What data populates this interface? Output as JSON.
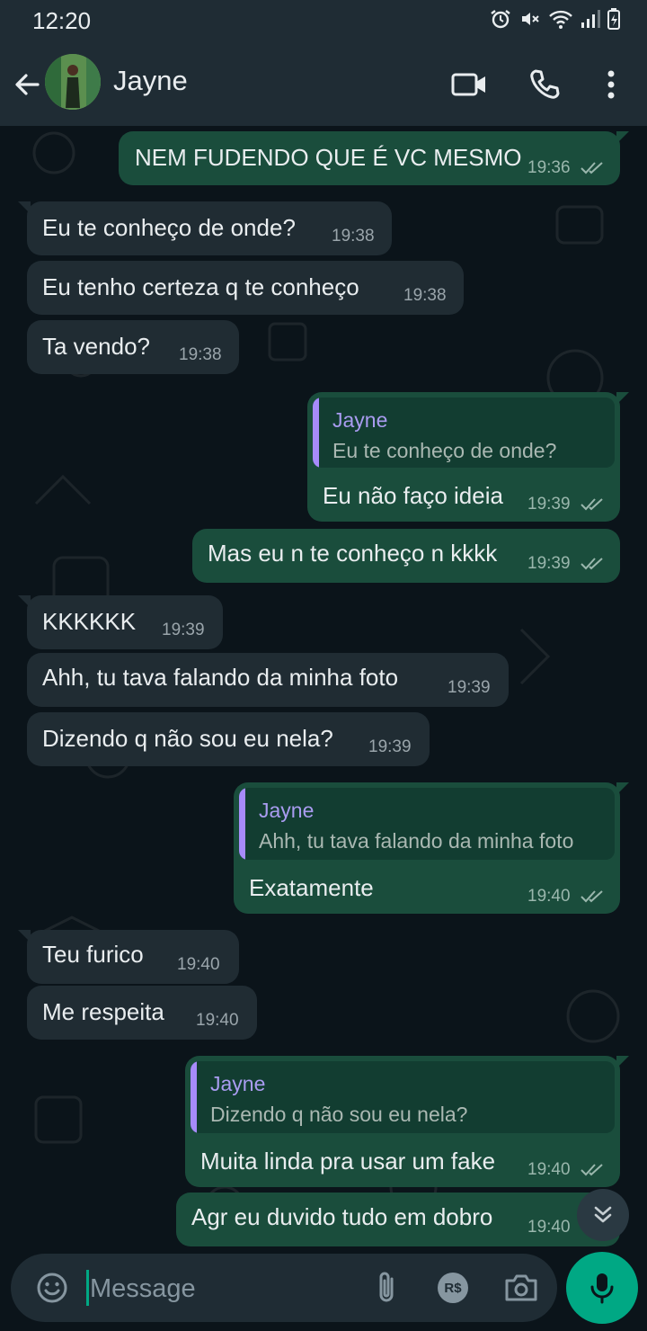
{
  "status_bar": {
    "time": "12:20"
  },
  "header": {
    "contact_name": "Jayne"
  },
  "colors": {
    "accent": "#00a884",
    "outgoing_bubble": "#1a4d3c",
    "incoming_bubble": "#202c33",
    "quote_bar": "#a78bfa"
  },
  "messages": [
    {
      "dir": "out",
      "text": "NEM FUDENDO QUE É VC MESMO",
      "time": "19:36"
    },
    {
      "dir": "in",
      "text": "Eu te conheço de onde?",
      "time": "19:38"
    },
    {
      "dir": "in",
      "text": "Eu tenho certeza q te conheço",
      "time": "19:38"
    },
    {
      "dir": "in",
      "text": "Ta vendo?",
      "time": "19:38"
    },
    {
      "dir": "out",
      "quote_name": "Jayne",
      "quote_text": "Eu te conheço de onde?",
      "text": "Eu não faço ideia",
      "time": "19:39"
    },
    {
      "dir": "out",
      "text": "Mas eu n te conheço n kkkk",
      "time": "19:39"
    },
    {
      "dir": "in",
      "text": "KKKKKK",
      "time": "19:39"
    },
    {
      "dir": "in",
      "text": "Ahh, tu tava falando da minha foto",
      "time": "19:39"
    },
    {
      "dir": "in",
      "text": "Dizendo q não sou eu nela?",
      "time": "19:39"
    },
    {
      "dir": "out",
      "quote_name": "Jayne",
      "quote_text": "Ahh, tu tava falando da minha foto",
      "text": "Exatamente",
      "time": "19:40"
    },
    {
      "dir": "in",
      "text": "Teu furico",
      "time": "19:40"
    },
    {
      "dir": "in",
      "text": "Me respeita",
      "time": "19:40"
    },
    {
      "dir": "out",
      "quote_name": "Jayne",
      "quote_text": "Dizendo q não sou eu nela?",
      "text": "Muita linda pra usar um fake",
      "time": "19:40"
    },
    {
      "dir": "out",
      "text": "Agr eu duvido tudo em dobro",
      "time": "19:40"
    }
  ],
  "input": {
    "placeholder": "Message",
    "payment_label": "R$"
  },
  "icons": [
    "back-arrow-icon",
    "video-call-icon",
    "phone-icon",
    "more-vert-icon",
    "emoji-icon",
    "attach-icon",
    "payment-icon",
    "camera-icon",
    "mic-icon",
    "chevron-double-down-icon"
  ]
}
